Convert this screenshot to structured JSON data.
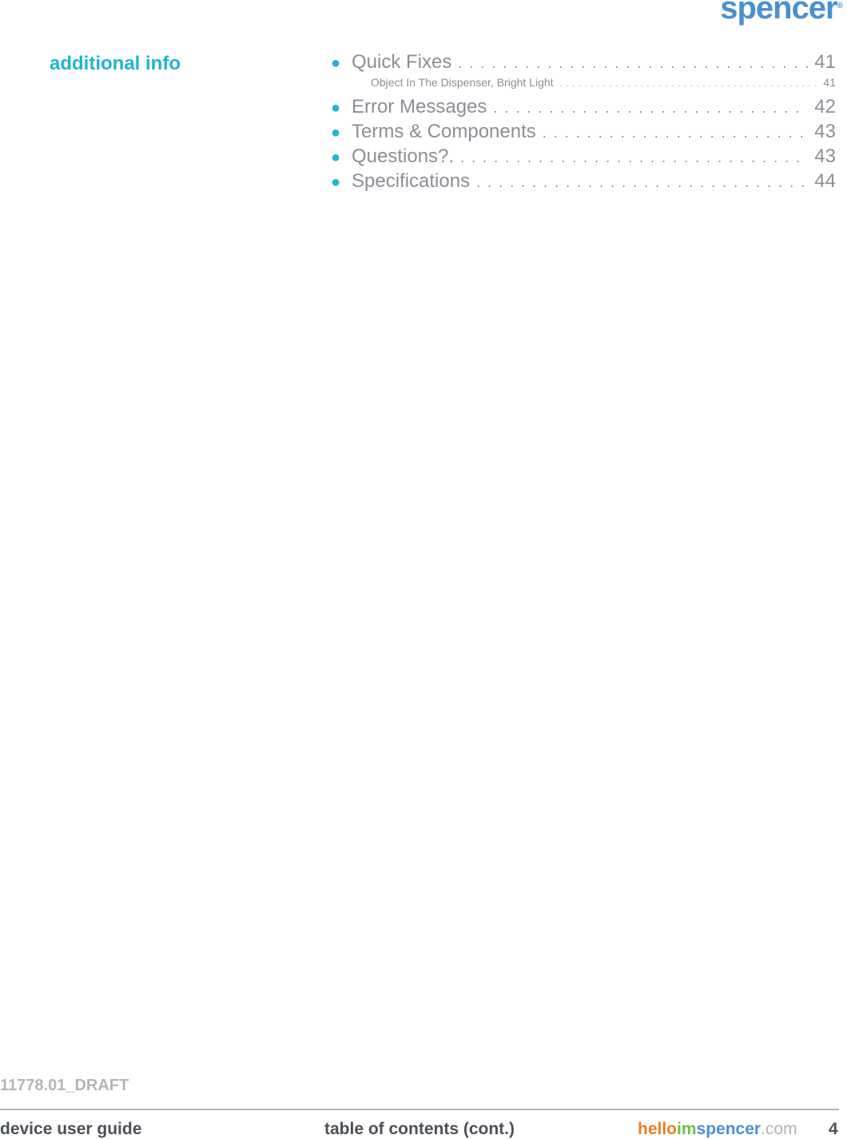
{
  "brand": {
    "logo": "spencer",
    "reg": "®"
  },
  "section_title": "additional info",
  "toc": [
    {
      "label": "Quick Fixes",
      "page": "41",
      "level": 1
    },
    {
      "label": "Object In The Dispenser, Bright Light",
      "page": "41",
      "level": 2
    },
    {
      "label": "Error Messages",
      "page": "42",
      "level": 1
    },
    {
      "label": "Terms & Components",
      "page": "43",
      "level": 1
    },
    {
      "label": "Questions?.",
      "page": "43",
      "level": 1
    },
    {
      "label": "Specifications",
      "page": "44",
      "level": 1
    }
  ],
  "footer": {
    "draft": "11778.01_DRAFT",
    "left": "device user guide",
    "center": "table of contents (cont.)",
    "site": {
      "hello": "hello",
      "im": "im",
      "spencer": "spencer",
      "com": ".com"
    },
    "page": "4"
  },
  "colors": {
    "accent": "#1fb4d2",
    "brand": "#4a90d0",
    "text": "#8a8f96"
  }
}
